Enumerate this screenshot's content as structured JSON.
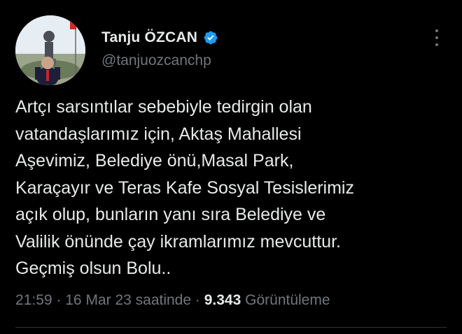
{
  "author": {
    "name": "Tanju ÖZCAN",
    "handle": "@tanjuozcanchp",
    "verified_color": "#1d9bf0"
  },
  "tweet": {
    "lines": [
      "Artçı sarsıntılar sebebiyle tedirgin olan",
      "vatandaşlarımız için, Aktaş Mahallesi",
      "Aşevimiz, Belediye önü,Masal Park,",
      "Karaçayır ve Teras Kafe Sosyal Tesislerimiz",
      "açık olup, bunların yanı sıra Belediye ve",
      "Valilik önünde çay ikramlarımız mevcuttur.",
      "Geçmiş olsun Bolu.."
    ]
  },
  "meta": {
    "time": "21:59",
    "date": "16 Mar 23 saatinde",
    "separator": "·",
    "views_count": "9.343",
    "views_label": "Görüntüleme"
  },
  "colors": {
    "background": "#000000",
    "text": "#e7e9ea",
    "secondary": "#71767b",
    "accent": "#1d9bf0"
  },
  "icons": {
    "more": "more-vertical-icon",
    "verified": "verified-badge-icon"
  }
}
